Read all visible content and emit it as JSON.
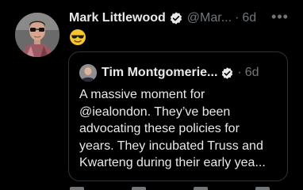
{
  "tweet": {
    "author_name": "Mark Littlewood",
    "handle": "@Mar...",
    "separator": "·",
    "time": "6d",
    "more_label": "•••",
    "text": "😎",
    "verified_icon": "verified-badge-icon",
    "emoji_icon": "sunglasses-emoji-icon"
  },
  "quote": {
    "author_name": "Tim Montgomerie...",
    "separator": "·",
    "time": "6d",
    "verified_icon": "verified-badge-icon",
    "text_lines": [
      "A massive moment for",
      "@iealondon. They’ve been",
      "advocating these policies for",
      "years. They incubated Truss and",
      "Kwarteng during their early yea..."
    ]
  },
  "colors": {
    "background": "#000000",
    "primary_text": "#e7e9ea",
    "secondary_text": "#71767b",
    "border": "#2f3336"
  }
}
